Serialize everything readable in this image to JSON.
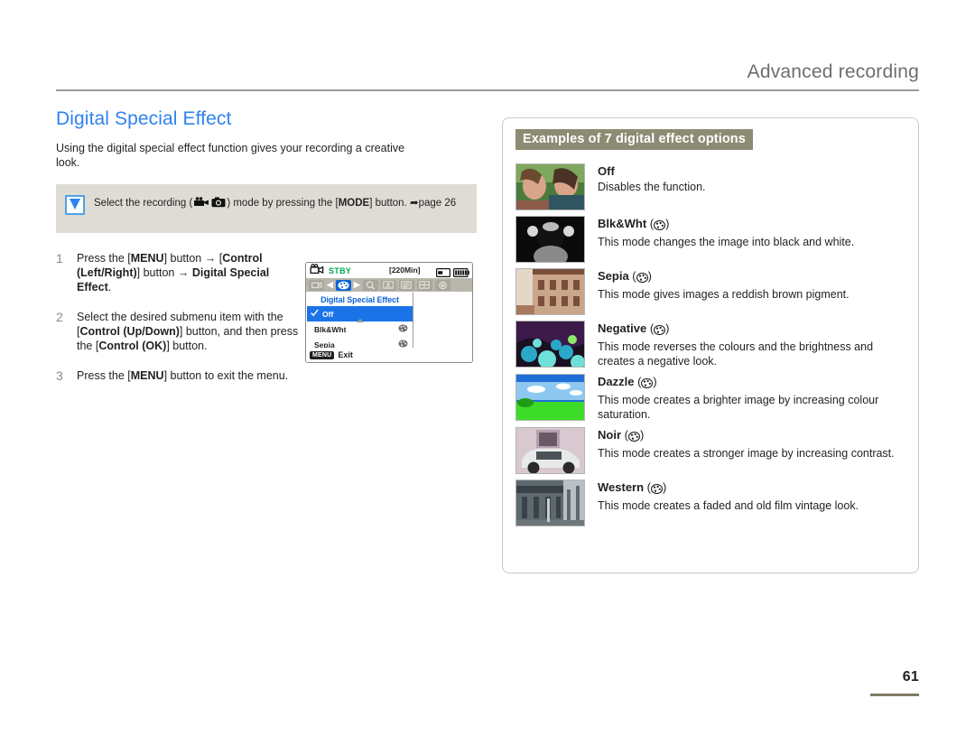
{
  "header": {
    "section": "Advanced recording"
  },
  "left": {
    "title": "Digital Special Effect",
    "intro": "Using the digital special effect function gives your recording a creative look.",
    "note": {
      "icon": "checkmark-icon",
      "text_before": "Select the recording (",
      "text_mid": ") mode by pressing the [",
      "mode_label": "MODE",
      "text_after": "] button.",
      "page_ref": "page 26"
    },
    "steps": [
      {
        "num": "1",
        "segments": [
          {
            "t": "Press the [",
            "b": false
          },
          {
            "t": "MENU",
            "b": true
          },
          {
            "t": "] button → [",
            "b": false
          },
          {
            "t": "Control (Left/Right)",
            "b": true
          },
          {
            "t": "] button → ",
            "b": false
          },
          {
            "t": "Digital Special Effect",
            "b": true
          },
          {
            "t": ".",
            "b": false
          }
        ]
      },
      {
        "num": "2",
        "segments": [
          {
            "t": "Select the desired submenu item with the [",
            "b": false
          },
          {
            "t": "Control (Up/Down)",
            "b": true
          },
          {
            "t": "] button, and then press the [",
            "b": false
          },
          {
            "t": "Control (OK)",
            "b": true
          },
          {
            "t": "] button.",
            "b": false
          }
        ]
      },
      {
        "num": "3",
        "segments": [
          {
            "t": "Press the [",
            "b": false
          },
          {
            "t": "MENU",
            "b": true
          },
          {
            "t": "] button to exit the menu.",
            "b": false
          }
        ]
      }
    ]
  },
  "lcd": {
    "status": "STBY",
    "remaining": "[220Min]",
    "menu_title": "Digital Special Effect",
    "items": [
      {
        "label": "Off",
        "selected": true,
        "has_check": true,
        "has_icon": false
      },
      {
        "label": "Blk&Wht",
        "selected": false,
        "has_check": false,
        "has_icon": true
      },
      {
        "label": "Sepia",
        "selected": false,
        "has_check": false,
        "has_icon": true
      }
    ],
    "exit_badge": "MENU",
    "exit_label": "Exit",
    "tabs": [
      {
        "name": "camera-tab",
        "selected": false
      },
      {
        "name": "palette-tab",
        "selected": true
      },
      {
        "name": "magnifier-tab",
        "selected": false
      },
      {
        "name": "portrait-tab",
        "selected": false
      },
      {
        "name": "list-tab",
        "selected": false
      },
      {
        "name": "grid-tab",
        "selected": false
      },
      {
        "name": "settings-tab",
        "selected": false
      }
    ]
  },
  "right": {
    "heading": "Examples of 7 digital effect options",
    "effects": [
      {
        "name": "Off",
        "has_icon": false,
        "description": "Disables the function.",
        "thumb": "children-photo",
        "colors": [
          "#4a7b3c",
          "#7da85e",
          "#8d5a4a",
          "#d8a48a"
        ]
      },
      {
        "name": "Blk&Wht",
        "has_icon": true,
        "description": "This mode changes the image into black and white.",
        "thumb": "bw-portrait",
        "colors": [
          "#0a0a0a",
          "#3a3a3a",
          "#d8d8d8",
          "#8a8a8a"
        ]
      },
      {
        "name": "Sepia",
        "has_icon": true,
        "description": "This mode gives images a reddish brown pigment.",
        "thumb": "sepia-building",
        "colors": [
          "#c9a58a",
          "#a8795c",
          "#e4d7c7",
          "#7a4f3a"
        ]
      },
      {
        "name": "Negative",
        "has_icon": true,
        "description": "This mode reverses the colours and the brightness and creates a negative look.",
        "thumb": "negative-flowers",
        "colors": [
          "#3c1a4a",
          "#2aa8c8",
          "#6ee0d8",
          "#1a1020"
        ]
      },
      {
        "name": "Dazzle",
        "has_icon": true,
        "description": "This mode creates a brighter image by increasing colour saturation.",
        "thumb": "dazzle-landscape",
        "colors": [
          "#1e6fd8",
          "#8ec8f0",
          "#ffffff",
          "#3ddc28"
        ]
      },
      {
        "name": "Noir",
        "has_icon": true,
        "description": "This mode creates a stronger image by increasing contrast.",
        "thumb": "noir-car",
        "colors": [
          "#d8c8d0",
          "#b8a0b0",
          "#e8eaea",
          "#2a2a2a"
        ]
      },
      {
        "name": "Western",
        "has_icon": true,
        "description": "This mode creates a faded and old film vintage look.",
        "thumb": "western-street",
        "colors": [
          "#8d9aa0",
          "#5e6a70",
          "#b8c0c4",
          "#3a4248"
        ]
      }
    ]
  },
  "footer": {
    "page_number": "61"
  }
}
